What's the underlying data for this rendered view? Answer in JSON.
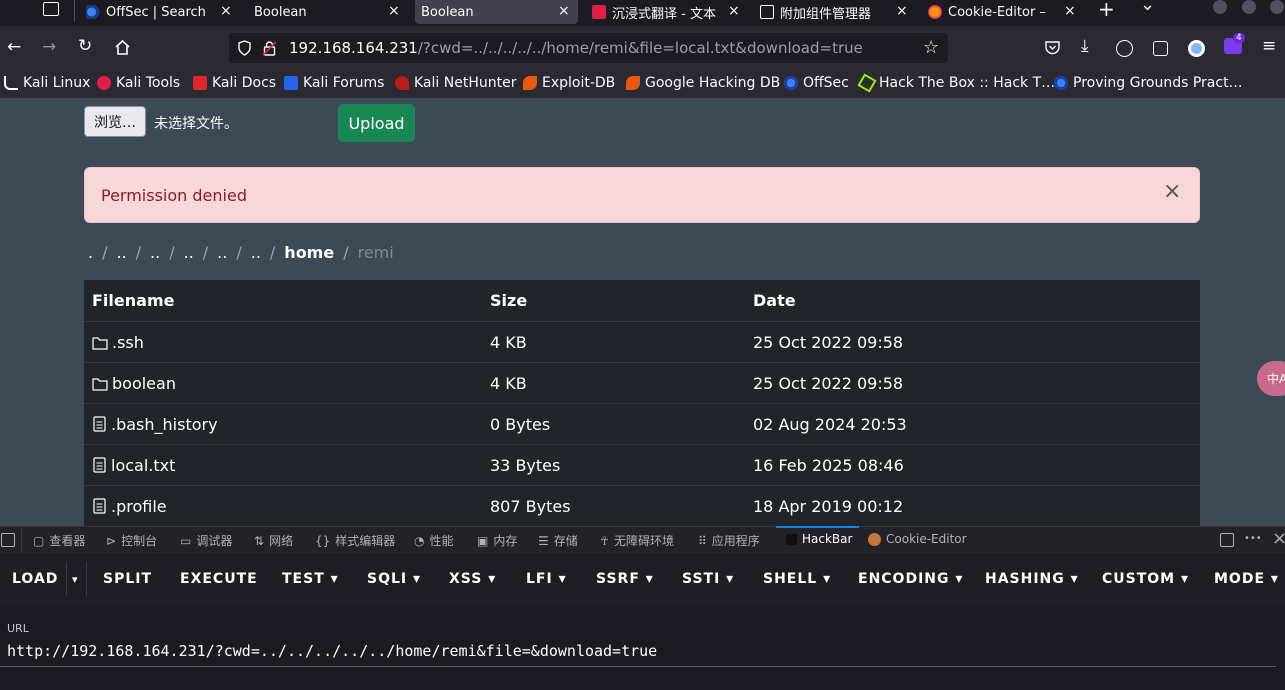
{
  "tabs": [
    {
      "label": "OffSec | Search",
      "close": "×"
    },
    {
      "label": "Boolean",
      "close": "×"
    },
    {
      "label": "Boolean",
      "close": "×",
      "active": true
    },
    {
      "label": "沉浸式翻译 - 文本",
      "close": "×"
    },
    {
      "label": "附加组件管理器",
      "close": "×"
    },
    {
      "label": "Cookie-Editor –",
      "close": "×"
    }
  ],
  "tabbar": {
    "new_tab": "+",
    "list_tabs": "⌄"
  },
  "address": {
    "host": "192.168.164.231",
    "path": "/?cwd=../../../../../home/remi&file=local.txt&download=true"
  },
  "toolbar": {
    "extensions_badge": "4"
  },
  "bookmarks": [
    "Kali Linux",
    "Kali Tools",
    "Kali Docs",
    "Kali Forums",
    "Kali NetHunter",
    "Exploit-DB",
    "Google Hacking DB",
    "OffSec",
    "Hack The Box :: Hack T…",
    "Proving Grounds Pract…"
  ],
  "upload_form": {
    "browse_label": "浏览…",
    "no_file_label": "未选择文件。",
    "upload_label": "Upload"
  },
  "alert": {
    "message": "Permission denied",
    "close": "×"
  },
  "breadcrumb": {
    "items": [
      ".",
      "..",
      "..",
      "..",
      "..",
      "..",
      "home",
      "remi"
    ],
    "separator": "/"
  },
  "table": {
    "headers": [
      "Filename",
      "Size",
      "Date"
    ],
    "rows": [
      {
        "type": "folder",
        "name": ".ssh",
        "size": "4 KB",
        "date": "25 Oct 2022 09:58"
      },
      {
        "type": "folder",
        "name": "boolean",
        "size": "4 KB",
        "date": "25 Oct 2022 09:58"
      },
      {
        "type": "file",
        "name": ".bash_history",
        "size": "0 Bytes",
        "date": "02 Aug 2024 20:53"
      },
      {
        "type": "file",
        "name": "local.txt",
        "size": "33 Bytes",
        "date": "16 Feb 2025 08:46"
      },
      {
        "type": "file",
        "name": ".profile",
        "size": "807 Bytes",
        "date": "18 Apr 2019 00:12"
      }
    ]
  },
  "translate_widget": "中A",
  "devtools": {
    "tabs": [
      "查看器",
      "控制台",
      "调试器",
      "网络",
      "样式编辑器",
      "性能",
      "内存",
      "存储",
      "无障碍环境",
      "应用程序",
      "HackBar",
      "Cookie-Editor"
    ],
    "active_tab": "HackBar",
    "more": "•••",
    "close": "×"
  },
  "hackbar": {
    "menu": [
      "LOAD",
      "SPLIT",
      "EXECUTE",
      "TEST ▾",
      "SQLI ▾",
      "XSS ▾",
      "LFI ▾",
      "SSRF ▾",
      "SSTI ▾",
      "SHELL ▾",
      "ENCODING ▾",
      "HASHING ▾",
      "CUSTOM ▾",
      "MODE ▾"
    ],
    "load_dropdown": "▾",
    "url_label": "URL",
    "url_value": "http://192.168.164.231/?cwd=../../../../../home/remi&file=&download=true"
  }
}
